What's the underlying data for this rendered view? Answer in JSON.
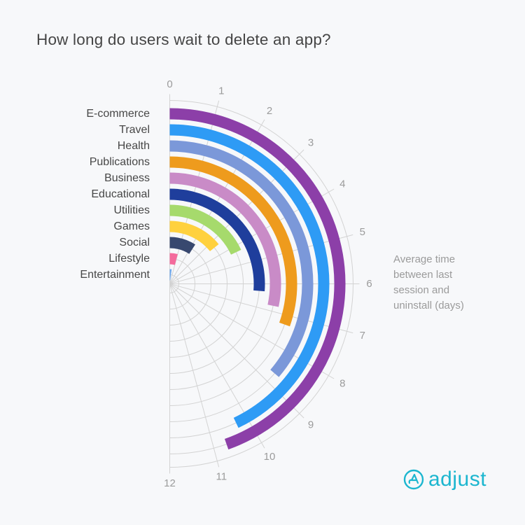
{
  "page": {
    "title": "How long do users wait to delete an app?"
  },
  "chart_data": {
    "type": "bar",
    "orientation": "radial",
    "title": "How long do users wait to delete an app?",
    "categories": [
      "E-commerce",
      "Travel",
      "Health",
      "Publications",
      "Business",
      "Educational",
      "Utilities",
      "Games",
      "Social",
      "Lifestyle",
      "Entertainment"
    ],
    "values": [
      10.7,
      10.3,
      8.7,
      7.3,
      6.8,
      6.3,
      4.3,
      3.4,
      2.2,
      1.0,
      0.5
    ],
    "colors": [
      "#8c3fa8",
      "#2e9bf5",
      "#7b98d9",
      "#ee9b1d",
      "#c98bc7",
      "#1f3e9c",
      "#a6da6c",
      "#ffd13e",
      "#38486f",
      "#f46b9c",
      "#6fa9ee"
    ],
    "axis": {
      "min": 0,
      "max": 12,
      "ticks": [
        0,
        1,
        2,
        3,
        4,
        5,
        6,
        7,
        8,
        9,
        10,
        11,
        12
      ],
      "tick_labels": [
        "0",
        "1",
        "2",
        "3",
        "4",
        "5",
        "6",
        "7",
        "8",
        "9",
        "10",
        "11",
        "12"
      ],
      "unit": "days"
    },
    "value_label": "Average time between last session and uninstall (days)",
    "value_label_lines": [
      "Average time",
      "between last",
      "session and",
      "uninstall (days)"
    ],
    "grid": true,
    "legend": "none"
  },
  "brand": {
    "name": "adjust",
    "icon": "adjust-logo-icon",
    "color": "#1cb6cf"
  }
}
